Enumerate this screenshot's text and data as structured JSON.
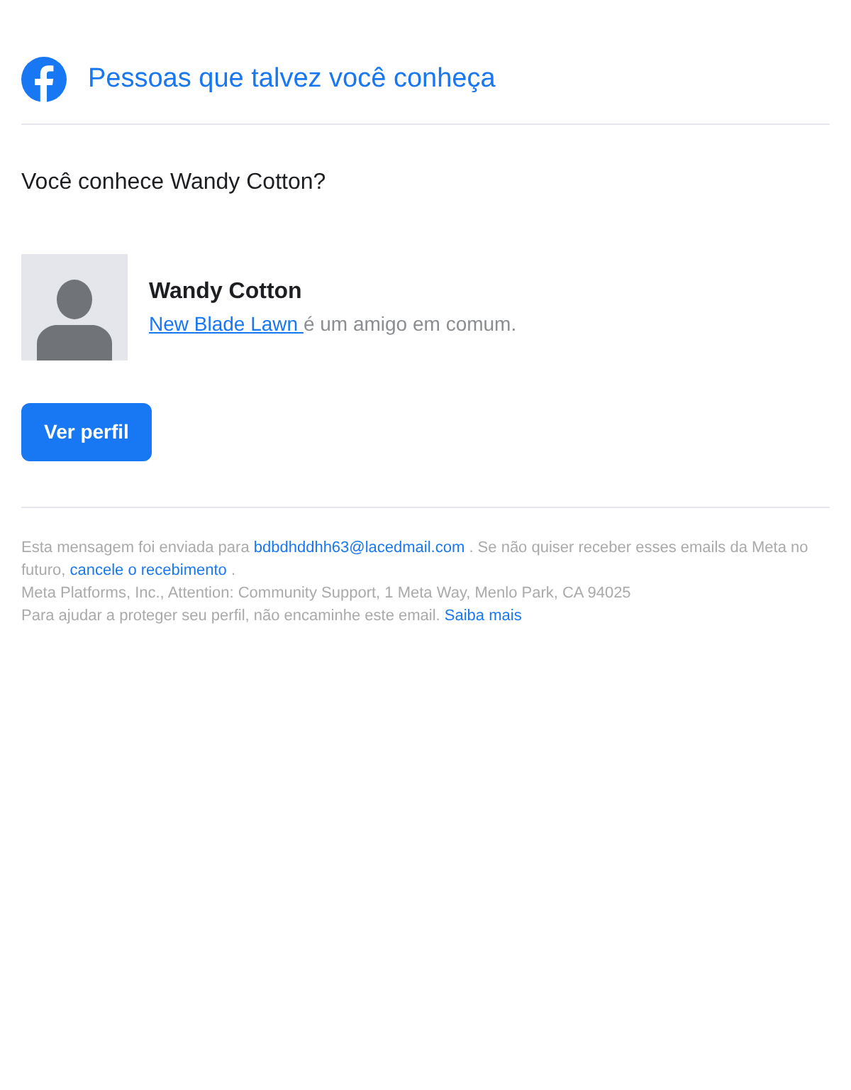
{
  "header": {
    "title": "Pessoas que talvez você conheça"
  },
  "question": "Você conhece Wandy Cotton?",
  "profile": {
    "name": "Wandy Cotton",
    "mutual_link": "New Blade Lawn ",
    "mutual_text": "é um amigo em comum."
  },
  "button": "Ver perfil",
  "footer": [
    [
      {
        "kind": "text",
        "text": "Esta mensagem foi enviada para "
      },
      {
        "kind": "link",
        "text": "bdbdhddhh63@lacedmail.com"
      },
      {
        "kind": "text",
        "text": " . Se não quiser receber esses emails da Meta no futuro, "
      },
      {
        "kind": "link",
        "text": "cancele o recebimento"
      },
      {
        "kind": "text",
        "text": " ."
      }
    ],
    [
      {
        "kind": "text",
        "text": "Meta Platforms, Inc., Attention: Community Support, 1 Meta Way, Menlo Park, CA 94025"
      }
    ],
    [
      {
        "kind": "text",
        "text": "Para ajudar a proteger seu perfil, não encaminhe este email. "
      },
      {
        "kind": "link",
        "text": "Saiba mais"
      }
    ]
  ]
}
